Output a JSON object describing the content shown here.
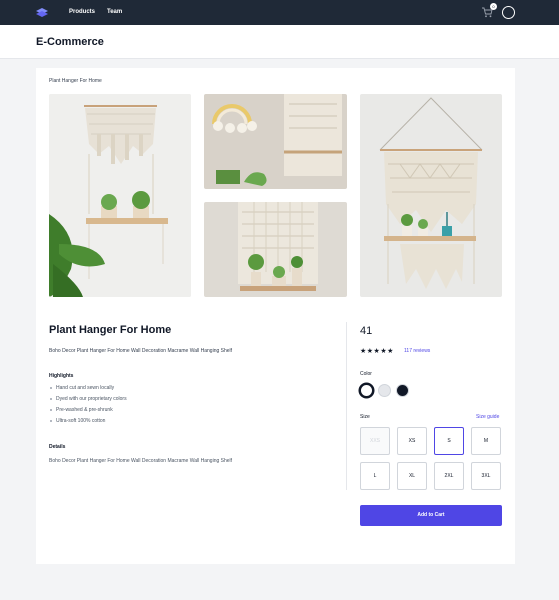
{
  "nav": {
    "links": [
      "Products",
      "Team"
    ],
    "cart_count": "0"
  },
  "header": {
    "title": "E-Commerce"
  },
  "breadcrumb": "Plant Hanger For Home",
  "product": {
    "title": "Plant Hanger For Home",
    "description": "Boho Decor Plant Hanger For Home Wall Decoration Macrame Wall Hanging Shelf",
    "price": "41",
    "rating": 5,
    "stars": "★★★★★",
    "reviews": "117 reviews",
    "highlights_label": "Highlights",
    "highlights": [
      "Hand cut and sewn locally",
      "Dyed with our proprietary colors",
      "Pre-washed & pre-shrunk",
      "Ultra-soft 100% cotton"
    ],
    "details_label": "Details",
    "details": "Boho Decor Plant Hanger For Home Wall Decoration Macrame Wall Hanging Shelf"
  },
  "options": {
    "color_label": "Color",
    "colors": [
      {
        "name": "White",
        "hex": "#ffffff",
        "selected": true
      },
      {
        "name": "Gray",
        "hex": "#e5e7eb",
        "selected": false
      },
      {
        "name": "Black",
        "hex": "#111827",
        "selected": false
      }
    ],
    "size_label": "Size",
    "size_guide": "Size guide",
    "sizes": [
      {
        "label": "XXS",
        "available": false,
        "selected": false
      },
      {
        "label": "XS",
        "available": true,
        "selected": false
      },
      {
        "label": "S",
        "available": true,
        "selected": true
      },
      {
        "label": "M",
        "available": true,
        "selected": false
      },
      {
        "label": "L",
        "available": true,
        "selected": false
      },
      {
        "label": "XL",
        "available": true,
        "selected": false
      },
      {
        "label": "2XL",
        "available": true,
        "selected": false
      },
      {
        "label": "3XL",
        "available": true,
        "selected": false
      }
    ],
    "add_to_cart": "Add to Cart"
  },
  "colors": {
    "nav_bg": "#1f2937",
    "accent": "#4f46e5",
    "page_bg": "#f3f4f6"
  },
  "icons": [
    "logo-icon",
    "cart-icon",
    "avatar-icon",
    "star-icon"
  ]
}
